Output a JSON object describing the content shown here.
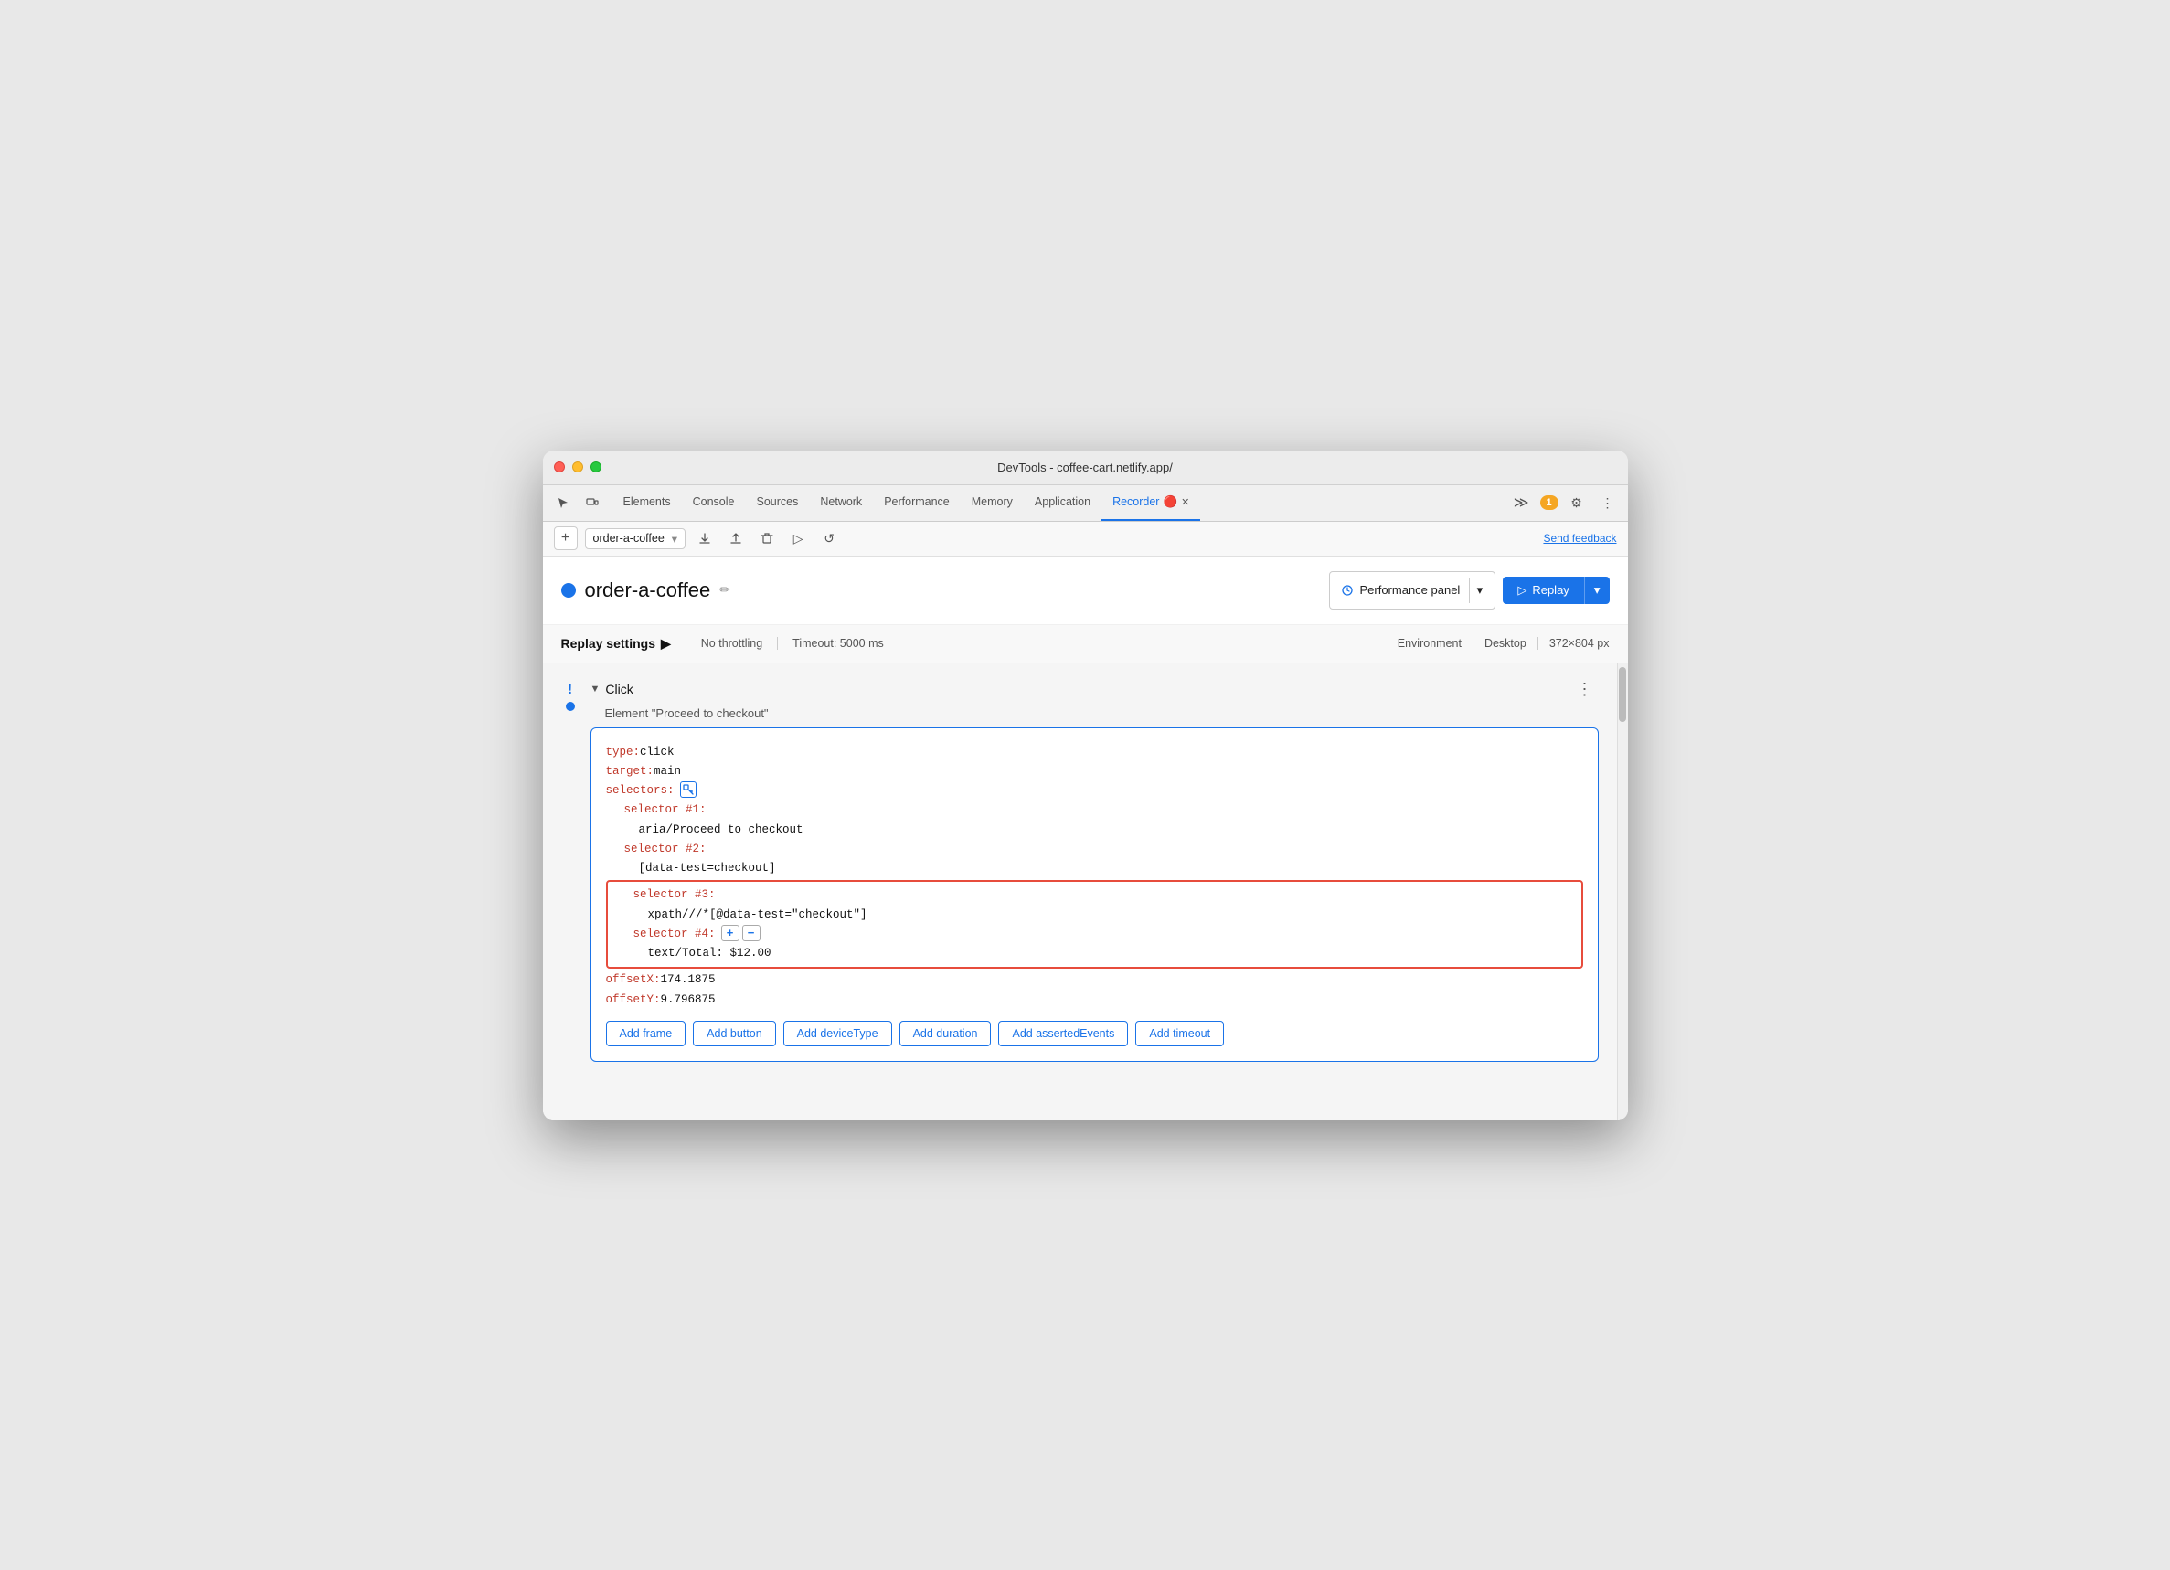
{
  "window": {
    "title": "DevTools - coffee-cart.netlify.app/"
  },
  "tabs": {
    "items": [
      {
        "label": "Elements",
        "active": false
      },
      {
        "label": "Console",
        "active": false
      },
      {
        "label": "Sources",
        "active": false
      },
      {
        "label": "Network",
        "active": false
      },
      {
        "label": "Performance",
        "active": false
      },
      {
        "label": "Memory",
        "active": false
      },
      {
        "label": "Application",
        "active": false
      },
      {
        "label": "Recorder",
        "active": true
      }
    ],
    "badge_count": "1",
    "more_tabs_icon": "≫"
  },
  "toolbar": {
    "recording_name": "order-a-coffee",
    "send_feedback": "Send feedback"
  },
  "recording": {
    "dot_color": "#1a73e8",
    "name": "order-a-coffee",
    "edit_icon": "✏",
    "perf_panel_label": "Performance panel",
    "replay_label": "Replay"
  },
  "replay_settings": {
    "title": "Replay settings",
    "expand_icon": "▶",
    "throttling": "No throttling",
    "timeout": "Timeout: 5000 ms",
    "environment_label": "Environment",
    "env_value": "Desktop",
    "resolution": "372×804 px"
  },
  "step": {
    "type": "Click",
    "description": "Element \"Proceed to checkout\"",
    "more_icon": "⋮",
    "code": {
      "type_key": "type:",
      "type_val": " click",
      "target_key": "target:",
      "target_val": " main",
      "selectors_key": "selectors:",
      "selector1_key": "selector #1:",
      "selector1_val": "aria/Proceed to checkout",
      "selector2_key": "selector #2:",
      "selector2_val": "[data-test=checkout]",
      "selector3_key": "selector #3:",
      "selector3_val": "xpath///*[@data-test=\"checkout\"]",
      "selector4_key": "selector #4:",
      "selector4_val": "text/Total: $12.00",
      "offsetX_key": "offsetX:",
      "offsetX_val": " 174.1875",
      "offsetY_key": "offsetY:",
      "offsetY_val": " 9.796875"
    }
  },
  "bottom_buttons": [
    "Add frame",
    "Add button",
    "Add deviceType",
    "Add duration",
    "Add assertedEvents",
    "Add timeout"
  ]
}
